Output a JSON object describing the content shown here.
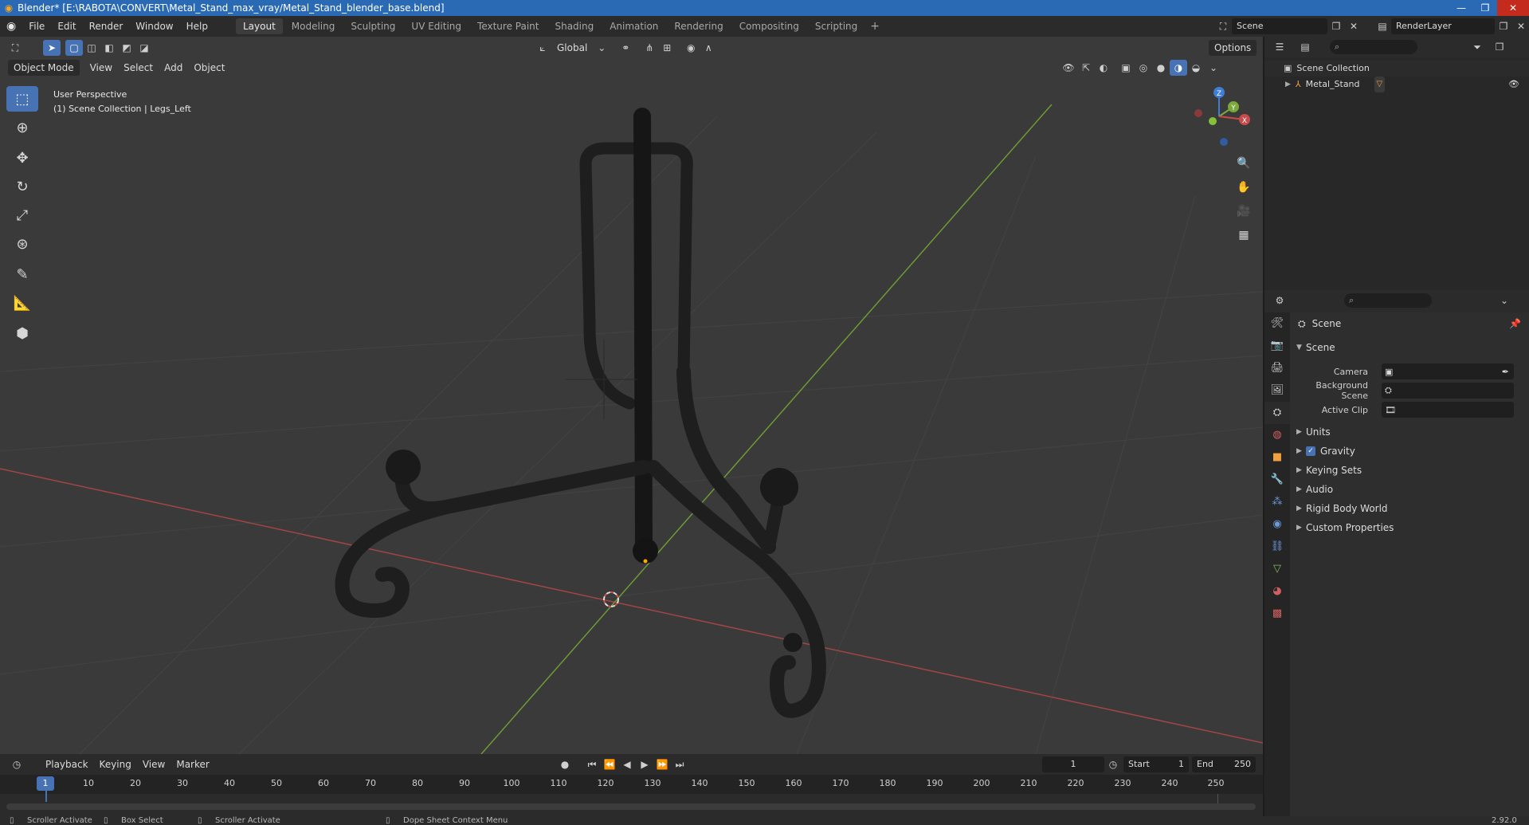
{
  "window": {
    "title": "Blender* [E:\\RABOTA\\CONVERT\\Metal_Stand_max_vray/Metal_Stand_blender_base.blend]",
    "controls": [
      "—",
      "❐",
      "✕"
    ]
  },
  "menu": [
    "File",
    "Edit",
    "Render",
    "Window",
    "Help"
  ],
  "workspaces": [
    "Layout",
    "Modeling",
    "Sculpting",
    "UV Editing",
    "Texture Paint",
    "Shading",
    "Animation",
    "Rendering",
    "Compositing",
    "Scripting"
  ],
  "workspace_add": "+",
  "scene_selector": {
    "value": "Scene"
  },
  "view_layer": {
    "value": "RenderLayer"
  },
  "viewport": {
    "mode": "Object Mode",
    "header_menu": [
      "View",
      "Select",
      "Add",
      "Object"
    ],
    "transform_orientation": "Global",
    "options_label": "Options",
    "info_line1": "User Perspective",
    "info_line2": "(1) Scene Collection | Legs_Left",
    "gizmo": {
      "z": "Z",
      "y": "Y",
      "x": "X"
    },
    "colors": {
      "x_axis": "#c84a4a",
      "y_axis": "#7aa83a",
      "z_axis": "#3f7cd6",
      "bg": "#3a3a3a",
      "grid": "#444444"
    }
  },
  "timeline": {
    "menu": [
      "Playback",
      "Keying",
      "View",
      "Marker"
    ],
    "current_frame": "1",
    "start_label": "Start",
    "start": "1",
    "end_label": "End",
    "end": "250",
    "ticks": [
      "1",
      "10",
      "20",
      "30",
      "40",
      "50",
      "60",
      "70",
      "80",
      "90",
      "100",
      "110",
      "120",
      "130",
      "140",
      "150",
      "160",
      "170",
      "180",
      "190",
      "200",
      "210",
      "220",
      "230",
      "240",
      "250"
    ]
  },
  "status": {
    "items": [
      "Scroller Activate",
      "Box Select",
      "Scroller Activate",
      "Dope Sheet Context Menu"
    ],
    "version": "2.92.0"
  },
  "outliner": {
    "root": "Scene Collection",
    "items": [
      {
        "label": "Metal_Stand"
      }
    ]
  },
  "properties": {
    "context": "Scene",
    "panel_title": "Scene",
    "fields": [
      {
        "label": "Camera",
        "value": ""
      },
      {
        "label": "Background Scene",
        "value": ""
      },
      {
        "label": "Active Clip",
        "value": ""
      }
    ],
    "collapsed_panels": [
      "Units",
      "Gravity",
      "Keying Sets",
      "Audio",
      "Rigid Body World",
      "Custom Properties"
    ],
    "gravity_checked": true
  }
}
